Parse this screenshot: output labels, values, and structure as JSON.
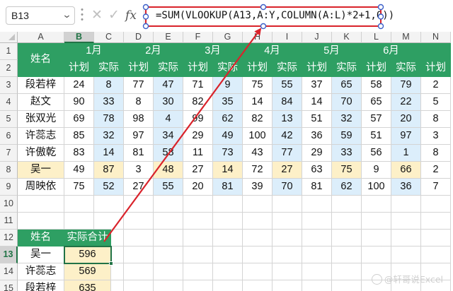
{
  "formula_bar": {
    "name_box": "B13",
    "name_box_arrow": "⌄",
    "cancel_glyph": "✕",
    "enter_glyph": "✓",
    "fx_glyph": "fx",
    "formula": "=SUM(VLOOKUP(A13,A:Y,COLUMN(A:L)*2+1,0))"
  },
  "columns": [
    "A",
    "B",
    "C",
    "D",
    "E",
    "F",
    "G",
    "H",
    "I",
    "J",
    "K",
    "L",
    "M",
    "N"
  ],
  "selected_column": "B",
  "row_numbers": [
    "1",
    "2",
    "3",
    "4",
    "5",
    "6",
    "7",
    "8",
    "9",
    "10",
    "11",
    "12",
    "13",
    "14",
    "15"
  ],
  "selected_row": "13",
  "table": {
    "months": [
      "1月",
      "2月",
      "3月",
      "4月",
      "5月",
      "6月"
    ],
    "name_header": "姓名",
    "plan_label": "计划",
    "actual_label": "实际",
    "rows": [
      {
        "name": "段若梓",
        "values": [
          "24",
          "8",
          "77",
          "47",
          "71",
          "9",
          "75",
          "55",
          "37",
          "65",
          "58",
          "79",
          "2"
        ]
      },
      {
        "name": "赵文",
        "values": [
          "90",
          "33",
          "8",
          "30",
          "82",
          "35",
          "14",
          "84",
          "14",
          "70",
          "65",
          "22",
          "5"
        ]
      },
      {
        "name": "张双光",
        "values": [
          "69",
          "78",
          "98",
          "4",
          "99",
          "62",
          "82",
          "13",
          "51",
          "32",
          "57",
          "20",
          "8"
        ]
      },
      {
        "name": "许蕊志",
        "values": [
          "85",
          "32",
          "97",
          "34",
          "29",
          "49",
          "100",
          "42",
          "36",
          "59",
          "51",
          "97",
          "3"
        ]
      },
      {
        "name": "许傲乾",
        "values": [
          "83",
          "14",
          "81",
          "58",
          "11",
          "73",
          "43",
          "77",
          "29",
          "33",
          "56",
          "1",
          "8"
        ]
      },
      {
        "name": "吴一",
        "values": [
          "49",
          "87",
          "3",
          "48",
          "27",
          "14",
          "72",
          "27",
          "63",
          "75",
          "9",
          "66",
          "2"
        ]
      },
      {
        "name": "周映依",
        "values": [
          "75",
          "52",
          "27",
          "55",
          "20",
          "81",
          "39",
          "70",
          "81",
          "62",
          "100",
          "36",
          "7"
        ]
      }
    ]
  },
  "result_table": {
    "headers": [
      "姓名",
      "实际合计"
    ],
    "rows": [
      {
        "name": "吴一",
        "total": "596"
      },
      {
        "name": "许蕊志",
        "total": "569"
      },
      {
        "name": "段若梓",
        "total": "635"
      }
    ]
  },
  "watermark": "@轩哥说Excel",
  "colors": {
    "header_green": "#2e9f63",
    "actual_blue": "#dceefb",
    "highlight_yellow": "#fdf0c8",
    "annotation_red": "#d9232b",
    "selection_green": "#217346"
  }
}
